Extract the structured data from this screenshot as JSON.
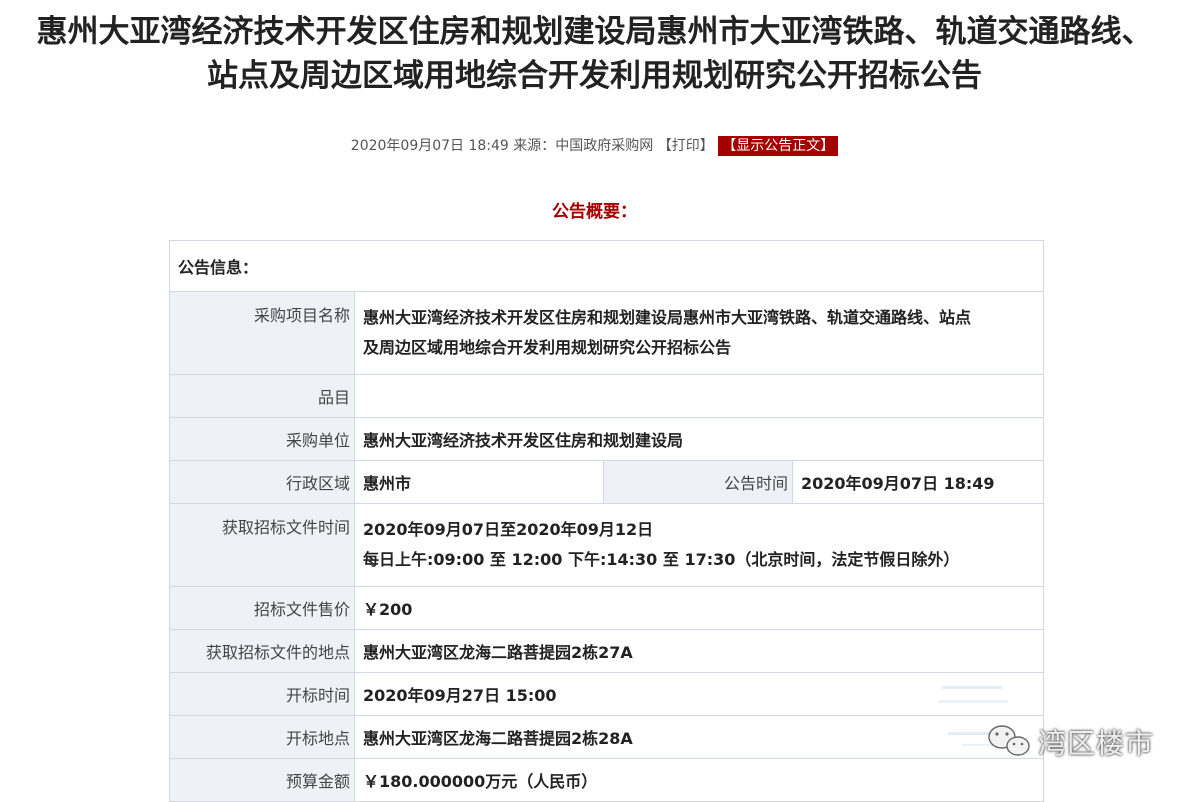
{
  "title_line1": "惠州大亚湾经济技术开发区住房和规划建设局惠州市大亚湾铁路、轨道交通路线、",
  "title_line2": "站点及周边区域用地综合开发利用规划研究公开招标公告",
  "meta": {
    "datetime": "2020年09月07日 18:49",
    "source": "来源：中国政府采购网",
    "print_label": "【打印】",
    "show_label": "【显示公告正文】"
  },
  "summary_heading": "公告概要：",
  "table": {
    "section_head": "公告信息：",
    "project_name_label": "采购项目名称",
    "project_name_value_1": "惠州大亚湾经济技术开发区住房和规划建设局惠州市大亚湾铁路、轨道交通路线、站点",
    "project_name_value_2": "及周边区域用地综合开发利用规划研究公开招标公告",
    "category_label": "品目",
    "category_value": "",
    "purchaser_label": "采购单位",
    "purchaser_value": "惠州大亚湾经济技术开发区住房和规划建设局",
    "region_label": "行政区域",
    "region_value": "惠州市",
    "announce_time_label": "公告时间",
    "announce_time_value": "2020年09月07日 18:49",
    "doc_time_label": "获取招标文件时间",
    "doc_time_value_1": "2020年09月07日至2020年09月12日",
    "doc_time_value_2": "每日上午:09:00 至 12:00  下午:14:30 至 17:30（北京时间，法定节假日除外）",
    "doc_price_label": "招标文件售价",
    "doc_price_value": "￥200",
    "doc_place_label": "获取招标文件的地点",
    "doc_place_value": "惠州大亚湾区龙海二路菩提园2栋27A",
    "open_time_label": "开标时间",
    "open_time_value": "2020年09月27日 15:00",
    "open_place_label": "开标地点",
    "open_place_value": "惠州大亚湾区龙海二路菩提园2栋28A",
    "budget_label": "预算金额",
    "budget_value": "￥180.000000万元（人民币）"
  },
  "watermark": {
    "text": "湾区楼市",
    "icon": "wechat-icon"
  },
  "colors": {
    "accent_red": "#a50000",
    "label_bg": "#eef2f7",
    "border": "#cfd8e3"
  }
}
